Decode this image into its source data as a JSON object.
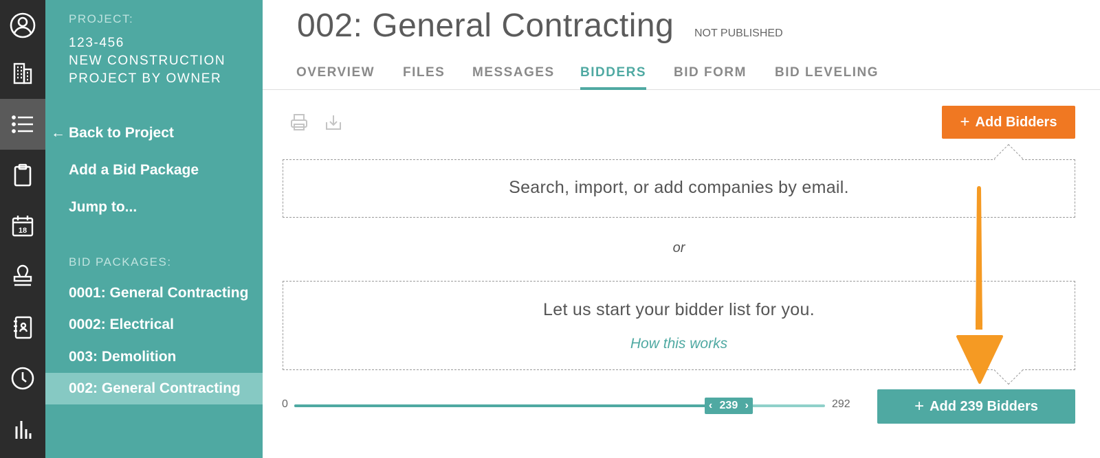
{
  "sidebar": {
    "project_caption": "PROJECT:",
    "project_number": "123-456",
    "project_name_line1": "NEW CONSTRUCTION",
    "project_name_line2": "PROJECT BY OWNER",
    "back_arrow": "←",
    "back_label": "Back to Project",
    "add_package_label": "Add a Bid Package",
    "jump_label": "Jump to...",
    "packages_caption": "BID PACKAGES:",
    "packages": [
      {
        "label": "0001: General Contracting"
      },
      {
        "label": "0002: Electrical"
      },
      {
        "label": "003: Demolition"
      },
      {
        "label": "002: General Contracting",
        "active": true
      }
    ]
  },
  "rail": {
    "items": [
      {
        "icon": "user-circle-icon"
      },
      {
        "icon": "building-icon"
      },
      {
        "icon": "list-icon",
        "active": true
      },
      {
        "icon": "clipboard-icon"
      },
      {
        "icon": "calendar-icon",
        "day": "18"
      },
      {
        "icon": "stamp-icon"
      },
      {
        "icon": "address-book-icon"
      },
      {
        "icon": "clock-icon"
      },
      {
        "icon": "bar-chart-icon"
      }
    ]
  },
  "header": {
    "title": "002: General Contracting",
    "status": "NOT PUBLISHED",
    "tabs": [
      {
        "label": "OVERVIEW"
      },
      {
        "label": "FILES"
      },
      {
        "label": "MESSAGES"
      },
      {
        "label": "BIDDERS",
        "active": true
      },
      {
        "label": "BID FORM"
      },
      {
        "label": "BID LEVELING"
      }
    ]
  },
  "content": {
    "add_bidders_plus": "+",
    "add_bidders_label": "Add Bidders",
    "search_prompt": "Search, import, or add companies by email.",
    "or_text": "or",
    "start_prompt": "Let us start your bidder list for you.",
    "how_link": "How this works",
    "slider": {
      "min": "0",
      "max": "292",
      "value": "239",
      "left_chevron": "‹",
      "right_chevron": "›",
      "fraction": 0.8185
    },
    "add_count_plus": "+",
    "add_count_label": "Add 239 Bidders"
  },
  "colors": {
    "teal": "#4fa9a2",
    "orange": "#f07822",
    "rail": "#2c2c2c",
    "annotation_arrow": "#f59a23"
  }
}
